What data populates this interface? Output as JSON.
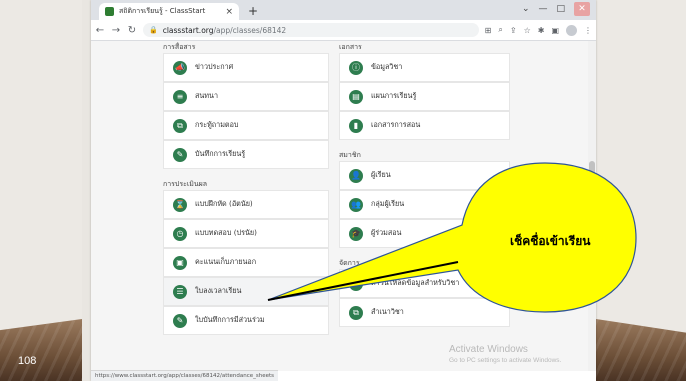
{
  "slide": {
    "number": "108"
  },
  "browser": {
    "tab_title": "สถิติการเรียนรู้ - ClassStart",
    "tab_close": "×",
    "new_tab": "+",
    "url_host": "classstart.org",
    "url_path": "/app/classes/68142",
    "status_url": "https://www.classstart.org/app/classes/68142/attendance_sheets"
  },
  "sections": {
    "communication": "การสื่อสาร",
    "evaluation": "การประเมินผล",
    "documents": "เอกสาร",
    "members": "สมาชิก",
    "management": "จัดการ"
  },
  "left_items_communication": [
    {
      "label": "ข่าวประกาศ",
      "icon": "megaphone-icon",
      "glyph": "📣"
    },
    {
      "label": "สนทนา",
      "icon": "chat-icon",
      "glyph": "≡"
    },
    {
      "label": "กระทู้ถามตอบ",
      "icon": "qa-icon",
      "glyph": "⧉"
    },
    {
      "label": "บันทึกการเรียนรู้",
      "icon": "journal-icon",
      "glyph": "✎"
    }
  ],
  "left_items_evaluation": [
    {
      "label": "แบบฝึกหัด (อัตนัย)",
      "icon": "exercise-icon",
      "glyph": "⌛"
    },
    {
      "label": "แบบทดสอบ (ปรนัย)",
      "icon": "quiz-icon",
      "glyph": "◷"
    },
    {
      "label": "คะแนนเก็บภายนอก",
      "icon": "briefcase-icon",
      "glyph": "▣"
    },
    {
      "label": "ใบลงเวลาเรียน",
      "icon": "attendance-icon",
      "glyph": "☰"
    },
    {
      "label": "ใบบันทึกการมีส่วนร่วม",
      "icon": "participation-icon",
      "glyph": "✎"
    }
  ],
  "right_items_documents": [
    {
      "label": "ข้อมูลวิชา",
      "icon": "info-icon",
      "glyph": "ⓘ"
    },
    {
      "label": "แผนการเรียนรู้",
      "icon": "plan-icon",
      "glyph": "▤"
    },
    {
      "label": "เอกสารการสอน",
      "icon": "document-icon",
      "glyph": "▮"
    }
  ],
  "right_items_members": [
    {
      "label": "ผู้เรียน",
      "icon": "learner-icon",
      "glyph": "👤"
    },
    {
      "label": "กลุ่มผู้เรียน",
      "icon": "group-icon",
      "glyph": "👥"
    },
    {
      "label": "ผู้ร่วมสอน",
      "icon": "co-teacher-icon",
      "glyph": "🎓"
    }
  ],
  "right_items_management": [
    {
      "label": "ดาวน์โหลดข้อมูลสำหรับวิชา",
      "icon": "download-icon",
      "glyph": "⇩"
    },
    {
      "label": "สำเนาวิชา",
      "icon": "copy-icon",
      "glyph": "⧉"
    }
  ],
  "watermark": {
    "line1": "Activate Windows",
    "line2": "Go to PC settings to activate Windows."
  },
  "callout": {
    "text": "เช็คชื่อเข้าเรียน"
  }
}
